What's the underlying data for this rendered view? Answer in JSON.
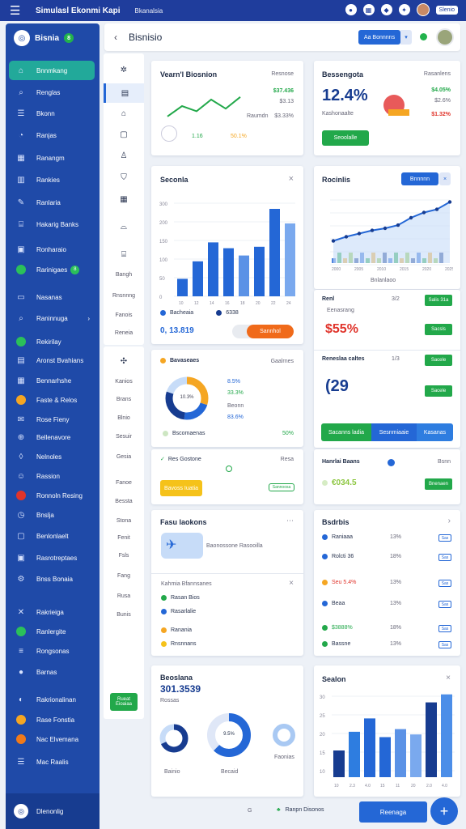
{
  "topbar": {
    "title": "Simulasl Ekonmi Kapi",
    "subtitle": "Bkanalsia",
    "badge": "Slenio"
  },
  "sidebar": {
    "brand": "Bisnia",
    "brand_badge": "8",
    "items": [
      {
        "label": "Bnnmkang",
        "icon": "home-icon"
      },
      {
        "label": "Renglas",
        "icon": "search-icon"
      },
      {
        "label": "Bkonn",
        "icon": "list-icon"
      },
      {
        "label": "Ranjas",
        "icon": "chart-icon"
      },
      {
        "label": "Ranangm",
        "icon": "grid-icon"
      },
      {
        "label": "Rankies",
        "icon": "layout-icon"
      },
      {
        "label": "Ranlaria",
        "icon": "pen-icon"
      },
      {
        "label": "Hakarig Banks",
        "icon": "bank-icon"
      },
      {
        "label": "Ronharaio",
        "icon": "calendar-icon"
      },
      {
        "label": "Rarinigaes",
        "icon": "circle-icon",
        "badge": "8"
      },
      {
        "label": "Nasanas",
        "icon": "folder-icon"
      },
      {
        "label": "Raninnuga",
        "icon": "search-icon"
      },
      {
        "label": "Rekirilay",
        "icon": "leaf-icon"
      },
      {
        "label": "Aronst Bvahians",
        "icon": "doc-icon"
      },
      {
        "label": "Bennarhshe",
        "icon": "table-icon"
      },
      {
        "label": "Faste & Relos",
        "icon": "coin-icon"
      },
      {
        "label": "Rose Fieny",
        "icon": "mail-icon"
      },
      {
        "label": "Bellenavore",
        "icon": "cart-icon"
      },
      {
        "label": "Nelnoles",
        "icon": "bell-icon"
      },
      {
        "label": "Rassion",
        "icon": "user-icon"
      },
      {
        "label": "Ronnoln Resing",
        "icon": "record-icon"
      },
      {
        "label": "Bnslja",
        "icon": "clock-icon"
      },
      {
        "label": "Benlonlaelt",
        "icon": "chat-icon"
      },
      {
        "label": "Rasrotreptaes",
        "icon": "box-icon"
      },
      {
        "label": "Bnss Bonaia",
        "icon": "gear-icon"
      },
      {
        "label": "Rakrieiga",
        "icon": "cross-icon"
      },
      {
        "label": "Ranlergite",
        "icon": "globe-icon"
      },
      {
        "label": "Rongsonas",
        "icon": "menu-icon"
      },
      {
        "label": "Barnas",
        "icon": "dot-icon"
      },
      {
        "label": "Rakrionalinan",
        "icon": "cup-icon"
      },
      {
        "label": "Rase Fonstia",
        "icon": "star-icon"
      },
      {
        "label": "Nac Elvemana",
        "icon": "flame-icon"
      },
      {
        "label": "Mac Raalis",
        "icon": "list-icon"
      }
    ],
    "footer": "Dlenonlig"
  },
  "header": {
    "title": "Bisnisio",
    "button": "Aa Bonnnns",
    "dropdown": "▾"
  },
  "rail": {
    "labels": [
      "Bangh",
      "Rnsnnng",
      "Fanois",
      "Reneia"
    ],
    "labels2": [
      "Kanios",
      "Brans",
      "Blnio",
      "Sesuir",
      "Gesia",
      "Fanoe",
      "Bessta",
      "Stona",
      "Fenit",
      "Fsls",
      "Fang",
      "Rusa",
      "Bunis"
    ],
    "button": "Rueat Eioaiaa"
  },
  "colors": {
    "primary": "#2467d6",
    "sidebar": "#1f4aa8",
    "green": "#22a84a",
    "orange": "#f07a1a",
    "red": "#e0342b"
  },
  "card1": {
    "title": "Vearn'l Biosnion",
    "meta": "Resnose",
    "v1": "$37.436",
    "v2": "$3.13",
    "v3": "$3.33%",
    "b1": "Raumdn",
    "l1": "1.16",
    "l2": "50.1%",
    "line": [
      18,
      10,
      14,
      5,
      12,
      3
    ]
  },
  "card2": {
    "title": "Bessengota",
    "meta": "Rasanlens",
    "big": "12.4%",
    "v1": "$4.05%",
    "v2": "$2.6%",
    "v3": "$1.32%",
    "label": "Kashonaalte",
    "button": "Seoolalle"
  },
  "card3": {
    "title": "Seconla",
    "ylabels": [
      "300",
      "200",
      "150",
      "100",
      "50",
      "0"
    ],
    "xlabels": [
      "10",
      "12",
      "14",
      "16",
      "18",
      "20",
      "22",
      "24"
    ],
    "legend1": "Bacheaia",
    "legend2": "6338",
    "value": "0, 13.819",
    "button": "Sannhol",
    "bars": [
      12,
      24,
      37,
      33,
      28,
      34,
      60,
      50
    ]
  },
  "card4": {
    "title": "Rocinlis",
    "button": "Bnnnnn",
    "note": "Bnlanlaoo",
    "xlabels": [
      "2000",
      "2005",
      "2010",
      "2015",
      "2020",
      "2025"
    ],
    "line": [
      18,
      22,
      25,
      28,
      30,
      33,
      40,
      45,
      48,
      55
    ]
  },
  "card5": {
    "t1": "Renl",
    "m1": "3/2",
    "v1": "$55%",
    "l1": "Eenasrang",
    "tag1": "Salis 31a",
    "tag2": "Sacsls",
    "t2": "Reneslaa caltes",
    "m2": "1/3",
    "v2": "(29",
    "tag3": "Sacele",
    "b1": "Sacanns ladia",
    "b2": "Sesnmiaaie",
    "b3": "Kasanas"
  },
  "card6": {
    "title": "Bavaseaes",
    "meta": "Gaalrnes",
    "center": "10.3%",
    "r1": "8.5%",
    "r2": "33.3%",
    "r3": "Beonn",
    "r4": "83.6%",
    "foot": "Bscomaenas",
    "footv": "50%",
    "donut": [
      30,
      22,
      28,
      20
    ]
  },
  "card7": {
    "title": "Res Gostone",
    "meta": "Resa",
    "button": "Bavoss Iuatia",
    "tag": "Sannoosa"
  },
  "card8": {
    "title": "Hanrlai Baans",
    "meta": "Bsnn",
    "value": "€034.5",
    "button": "Bnenaen"
  },
  "card9": {
    "title": "Fasu laokons",
    "caption": "Baonossone Rasooilla",
    "sub": "Kahmia Bfannsanes",
    "rows": [
      "Rasan Bios",
      "Rasarlalie",
      "Ranania",
      "Rnsnnans"
    ]
  },
  "card10": {
    "title": "Bsdrbis",
    "rows": [
      {
        "name": "Raniaaa",
        "val": "13%",
        "tag": "Sas",
        "color": "#2467d6"
      },
      {
        "name": "Rolcti 36",
        "val": "18%",
        "tag": "Sas",
        "color": "#2467d6"
      },
      {
        "name": "Seu 5.4%",
        "val": "13%",
        "tag": "Sas",
        "color": "#f5a623"
      },
      {
        "name": "Beaa",
        "val": "13%",
        "tag": "Sas",
        "color": "#2467d6"
      },
      {
        "name": "$3888%",
        "val": "18%",
        "tag": "Sas",
        "color": "#22a84a"
      },
      {
        "name": "Bassne",
        "val": "13%",
        "tag": "Sas",
        "color": "#22a84a"
      }
    ]
  },
  "card11": {
    "title": "Beoslana",
    "value": "301.3539",
    "meta": "Rossas",
    "center": "9.5%",
    "d1": "Bainio",
    "d2": "Becaid",
    "d3": "Faonias"
  },
  "card12": {
    "title": "Sealon",
    "ylabels": [
      "30",
      "25",
      "20",
      "15",
      "10"
    ],
    "xlabels": [
      "10",
      "2.3",
      "4.0",
      "15",
      "11",
      "20",
      "2.0",
      "4.0"
    ],
    "bars": [
      10,
      17,
      22,
      15,
      18,
      16,
      28,
      31
    ]
  },
  "bottombar": {
    "left": "G",
    "center": "Ranpn Disonos",
    "button": "Reenaga"
  }
}
